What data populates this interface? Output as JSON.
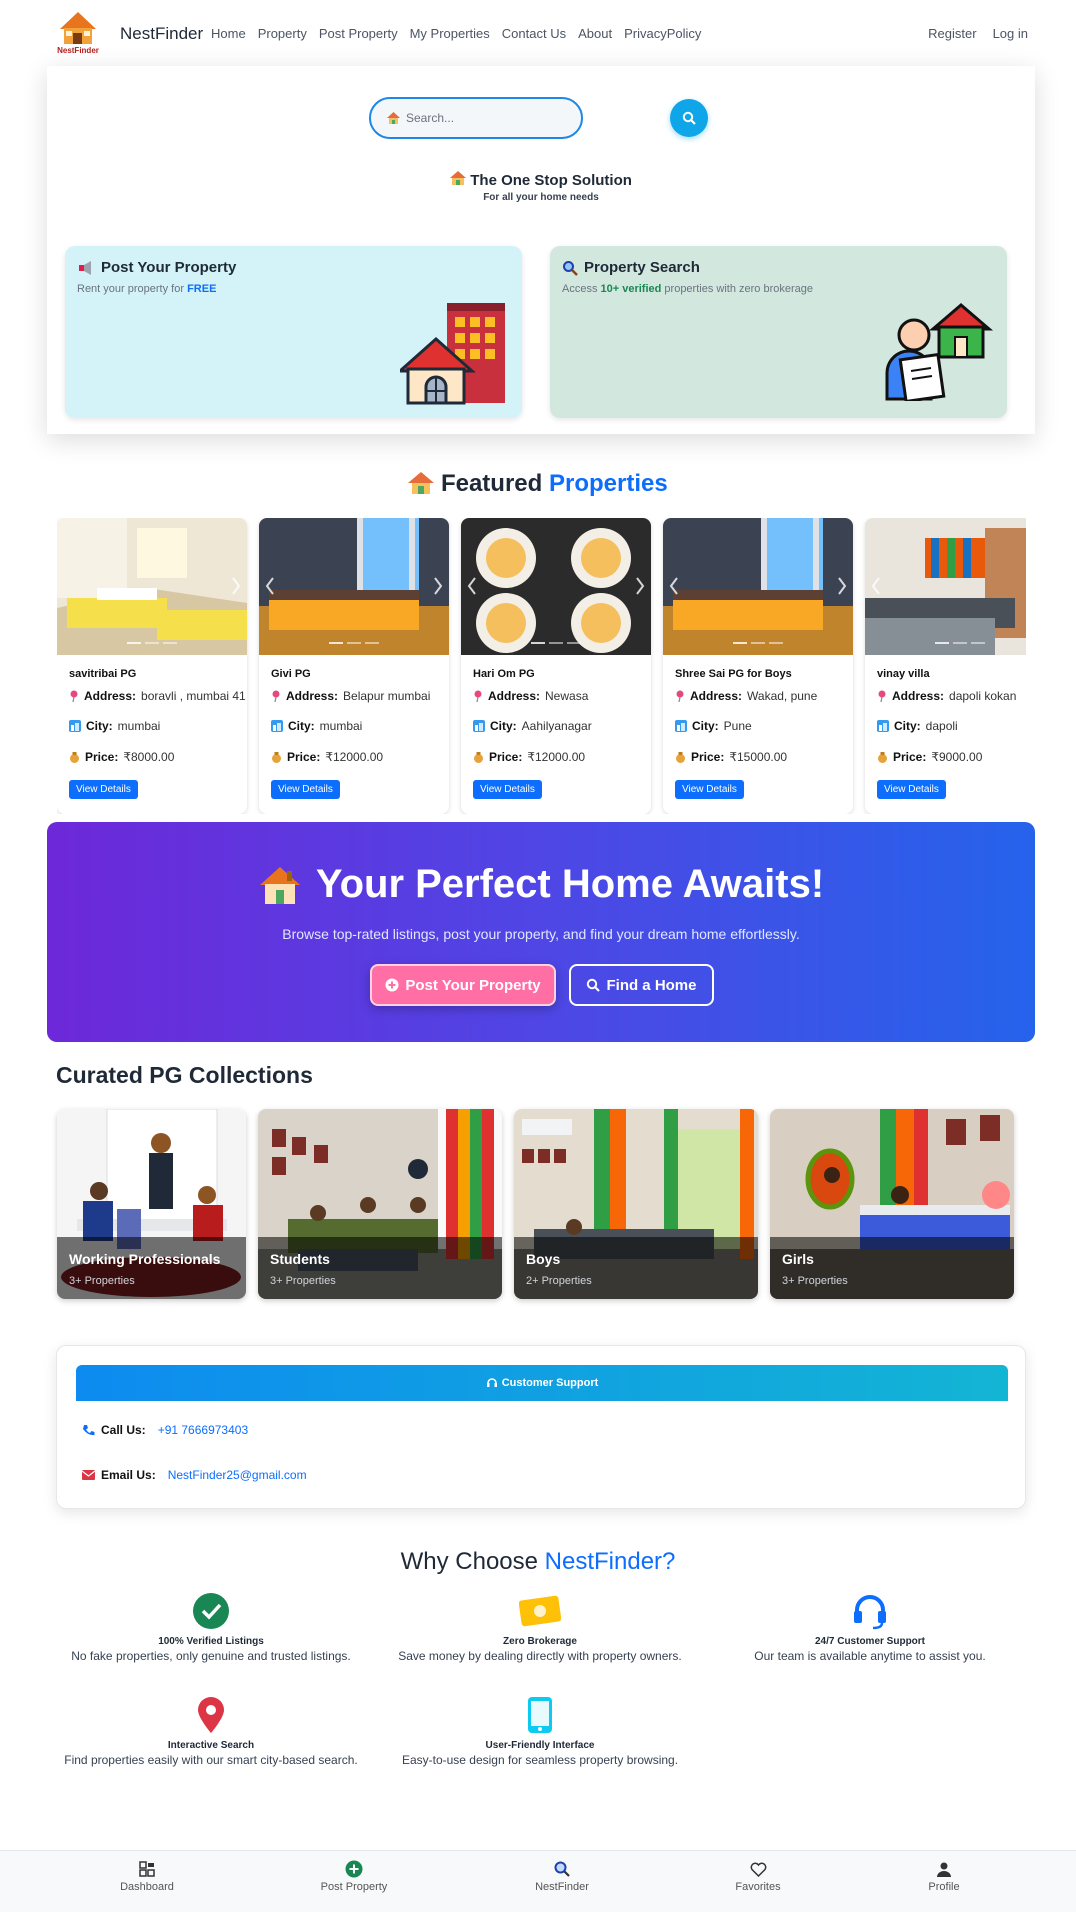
{
  "nav": {
    "brand": "NestFinder",
    "logo_text": "NestFinder",
    "links": [
      "Home",
      "Property",
      "Post Property",
      "My Properties",
      "Contact Us",
      "About",
      "PrivacyPolicy"
    ],
    "register": "Register",
    "login": "Log in"
  },
  "hero": {
    "search_placeholder": "Search...",
    "tagline_title": "The One Stop Solution",
    "tagline_sub": "For all your home needs",
    "post_card": {
      "title": "Post Your Property",
      "sub_prefix": "Rent your property for ",
      "sub_highlight": "FREE"
    },
    "search_card": {
      "title": "Property Search",
      "sub_prefix": "Access ",
      "sub_highlight": "10+ verified",
      "sub_suffix": " properties with zero brokerage"
    }
  },
  "featured": {
    "title_main": "Featured ",
    "title_accent": "Properties",
    "address_label": "Address:",
    "city_label": "City:",
    "price_label": "Price:",
    "button": "View Details",
    "cards": [
      {
        "name": "savitribai PG",
        "address": "boravli , mumbai 41",
        "city": "mumbai",
        "price": "₹8000.00"
      },
      {
        "name": "Givi PG",
        "address": "Belapur mumbai",
        "city": "mumbai",
        "price": "₹12000.00"
      },
      {
        "name": "Hari Om PG",
        "address": "Newasa",
        "city": "Aahilyanagar",
        "price": "₹12000.00"
      },
      {
        "name": "Shree Sai PG for Boys",
        "address": "Wakad, pune",
        "city": "Pune",
        "price": "₹15000.00"
      },
      {
        "name": "vinay villa",
        "address": "dapoli kokan",
        "city": "dapoli",
        "price": "₹9000.00"
      }
    ]
  },
  "banner": {
    "title": "Your Perfect Home Awaits!",
    "subtitle": "Browse top-rated listings, post your property, and find your dream home effortlessly.",
    "post_button": "Post Your Property",
    "find_button": "Find a Home"
  },
  "curated": {
    "title": "Curated PG Collections",
    "items": [
      {
        "name": "Working Professionals",
        "count": "3+ Properties"
      },
      {
        "name": "Students",
        "count": "3+ Properties"
      },
      {
        "name": "Boys",
        "count": "2+ Properties"
      },
      {
        "name": "Girls",
        "count": "3+ Properties"
      }
    ]
  },
  "support": {
    "header": "Customer Support",
    "call_label": "Call Us:",
    "call_value": "+91 7666973403",
    "email_label": "Email Us:",
    "email_value": "NestFinder25@gmail.com"
  },
  "why": {
    "title_main": "Why Choose ",
    "title_accent": "NestFinder?",
    "items": [
      {
        "title": "100% Verified Listings",
        "desc": "No fake properties, only genuine and trusted listings."
      },
      {
        "title": "Zero Brokerage",
        "desc": "Save money by dealing directly with property owners."
      },
      {
        "title": "24/7 Customer Support",
        "desc": "Our team is available anytime to assist you."
      },
      {
        "title": "Interactive Search",
        "desc": "Find properties easily with our smart city-based search."
      },
      {
        "title": "User-Friendly Interface",
        "desc": "Easy-to-use design for seamless property browsing."
      }
    ]
  },
  "bottom_nav": [
    "Dashboard",
    "Post Property",
    "NestFinder",
    "Favorites",
    "Profile"
  ],
  "colors": {
    "primary": "#0d6efd",
    "accent_pink": "#ff6fa5",
    "banner_start": "#6d28d9",
    "banner_end": "#2563eb"
  }
}
